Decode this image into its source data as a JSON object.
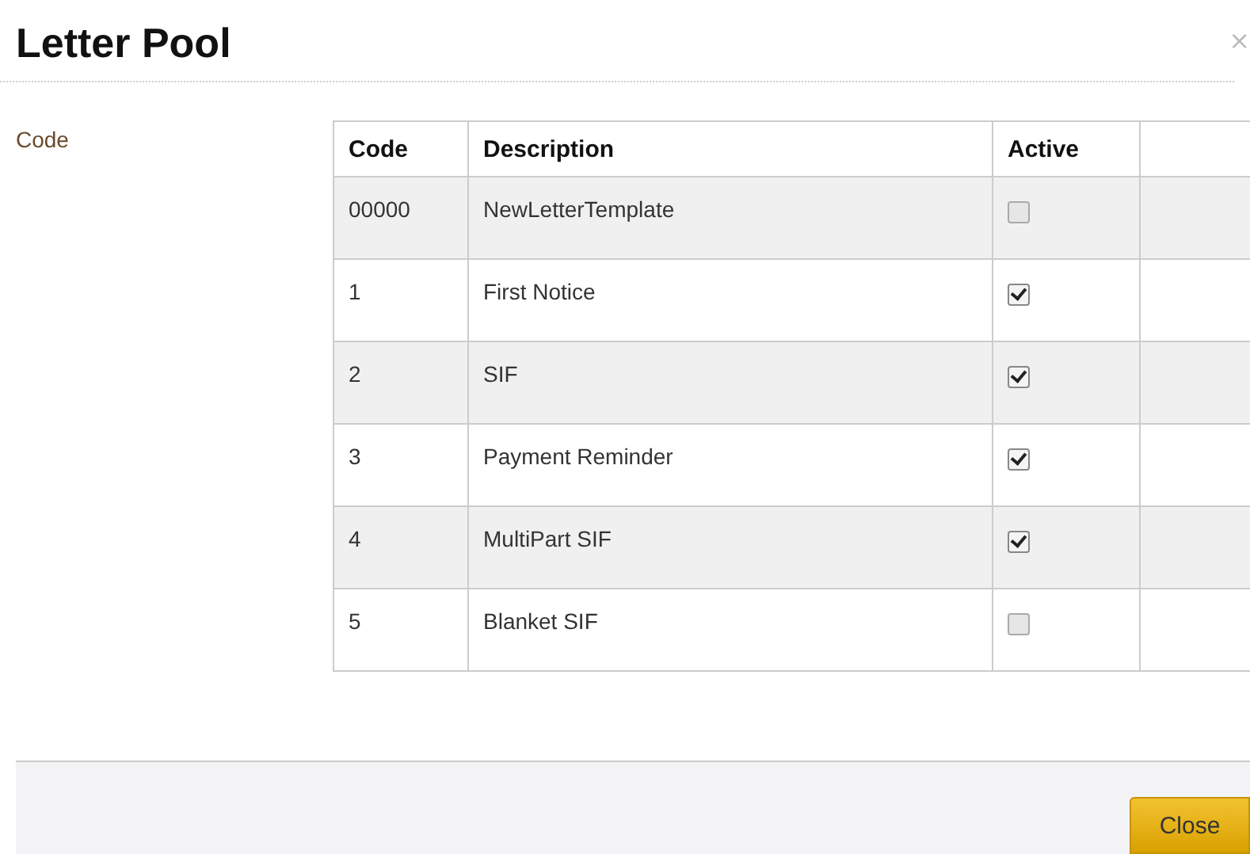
{
  "dialog": {
    "title": "Letter Pool",
    "close_glyph": "×"
  },
  "field_label": "Code",
  "table": {
    "columns": [
      "Code",
      "Description",
      "Active"
    ],
    "rows": [
      {
        "code": "00000",
        "description": "NewLetterTemplate",
        "active": false
      },
      {
        "code": "1",
        "description": "First Notice",
        "active": true
      },
      {
        "code": "2",
        "description": "SIF",
        "active": true
      },
      {
        "code": "3",
        "description": "Payment Reminder",
        "active": true
      },
      {
        "code": "4",
        "description": "MultiPart SIF",
        "active": true
      },
      {
        "code": "5",
        "description": "Blanket SIF",
        "active": false
      }
    ]
  },
  "footer": {
    "button": "Close"
  }
}
